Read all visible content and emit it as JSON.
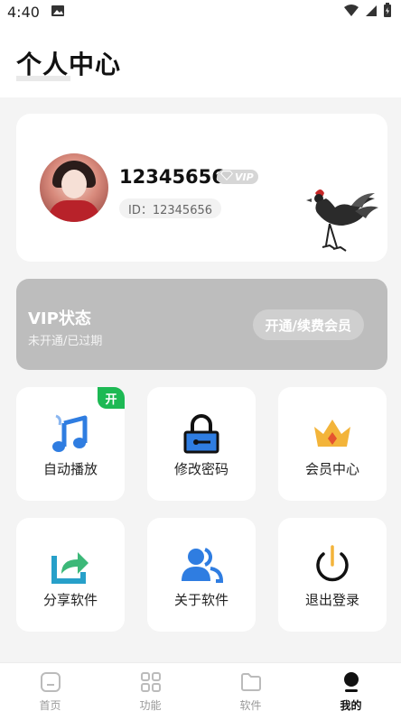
{
  "status_bar": {
    "time": "4:40"
  },
  "header": {
    "title": "个人中心"
  },
  "profile": {
    "username": "12345656",
    "vip_badge": "VIP",
    "id_text": "ID：12345656"
  },
  "vip_card": {
    "title": "VIP状态",
    "subtitle": "未开通/已过期",
    "button": "开通/续费会员"
  },
  "tiles": [
    {
      "label": "自动播放",
      "icon": "music-note-icon",
      "tag": "开"
    },
    {
      "label": "修改密码",
      "icon": "lock-icon"
    },
    {
      "label": "会员中心",
      "icon": "crown-icon"
    },
    {
      "label": "分享软件",
      "icon": "share-icon"
    },
    {
      "label": "关于软件",
      "icon": "people-icon"
    },
    {
      "label": "退出登录",
      "icon": "power-icon"
    }
  ],
  "bottom_nav": [
    {
      "label": "首页",
      "icon": "home-icon"
    },
    {
      "label": "功能",
      "icon": "grid-icon"
    },
    {
      "label": "软件",
      "icon": "folder-icon"
    },
    {
      "label": "我的",
      "icon": "profile-icon",
      "active": true
    }
  ],
  "colors": {
    "accent_green": "#1db954",
    "vip_card_bg": "#bdbdbd",
    "icon_blue": "#2f7de1",
    "crown_gold": "#f3b43a"
  }
}
